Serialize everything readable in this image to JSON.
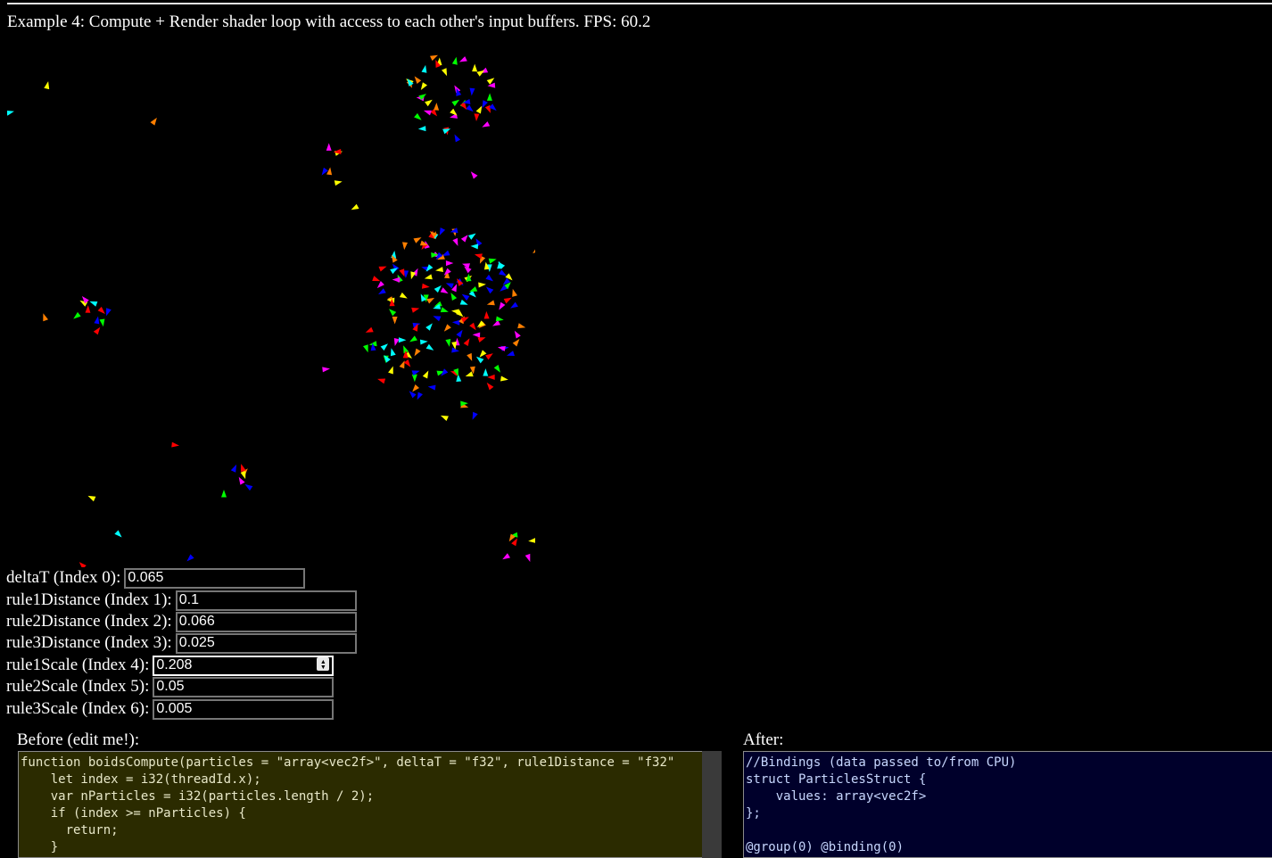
{
  "header": {
    "title": "Example 4: Compute + Render shader loop with access to each other's input buffers. FPS: 60.2"
  },
  "params": [
    {
      "label": "deltaT (Index 0):",
      "value": "0.065"
    },
    {
      "label": "rule1Distance (Index 1):",
      "value": "0.1"
    },
    {
      "label": "rule2Distance (Index 2):",
      "value": "0.066"
    },
    {
      "label": "rule3Distance (Index 3):",
      "value": "0.025"
    },
    {
      "label": "rule1Scale (Index 4):",
      "value": "0.208"
    },
    {
      "label": "rule2Scale (Index 5):",
      "value": "0.05"
    },
    {
      "label": "rule3Scale (Index 6):",
      "value": "0.005"
    }
  ],
  "before": {
    "label": "Before (edit me!):",
    "code": "function boidsCompute(particles = \"array<vec2f>\", deltaT = \"f32\", rule1Distance = \"f32\"\n    let index = i32(threadId.x);\n    var nParticles = i32(particles.length / 2);\n    if (index >= nParticles) {\n      return;\n    }"
  },
  "after": {
    "label": "After:",
    "code": "//Bindings (data passed to/from CPU)\nstruct ParticlesStruct {\n    values: array<vec2f>\n};\n\n@group(0) @binding(0)"
  },
  "colors": {
    "background": "#000000",
    "before_bg": "#2b2b00",
    "after_bg": "#00002b",
    "boid_palette": [
      "#ff0000",
      "#ff7f00",
      "#ffff00",
      "#00ff00",
      "#0000ff",
      "#ff00ff",
      "#00ffff"
    ]
  }
}
